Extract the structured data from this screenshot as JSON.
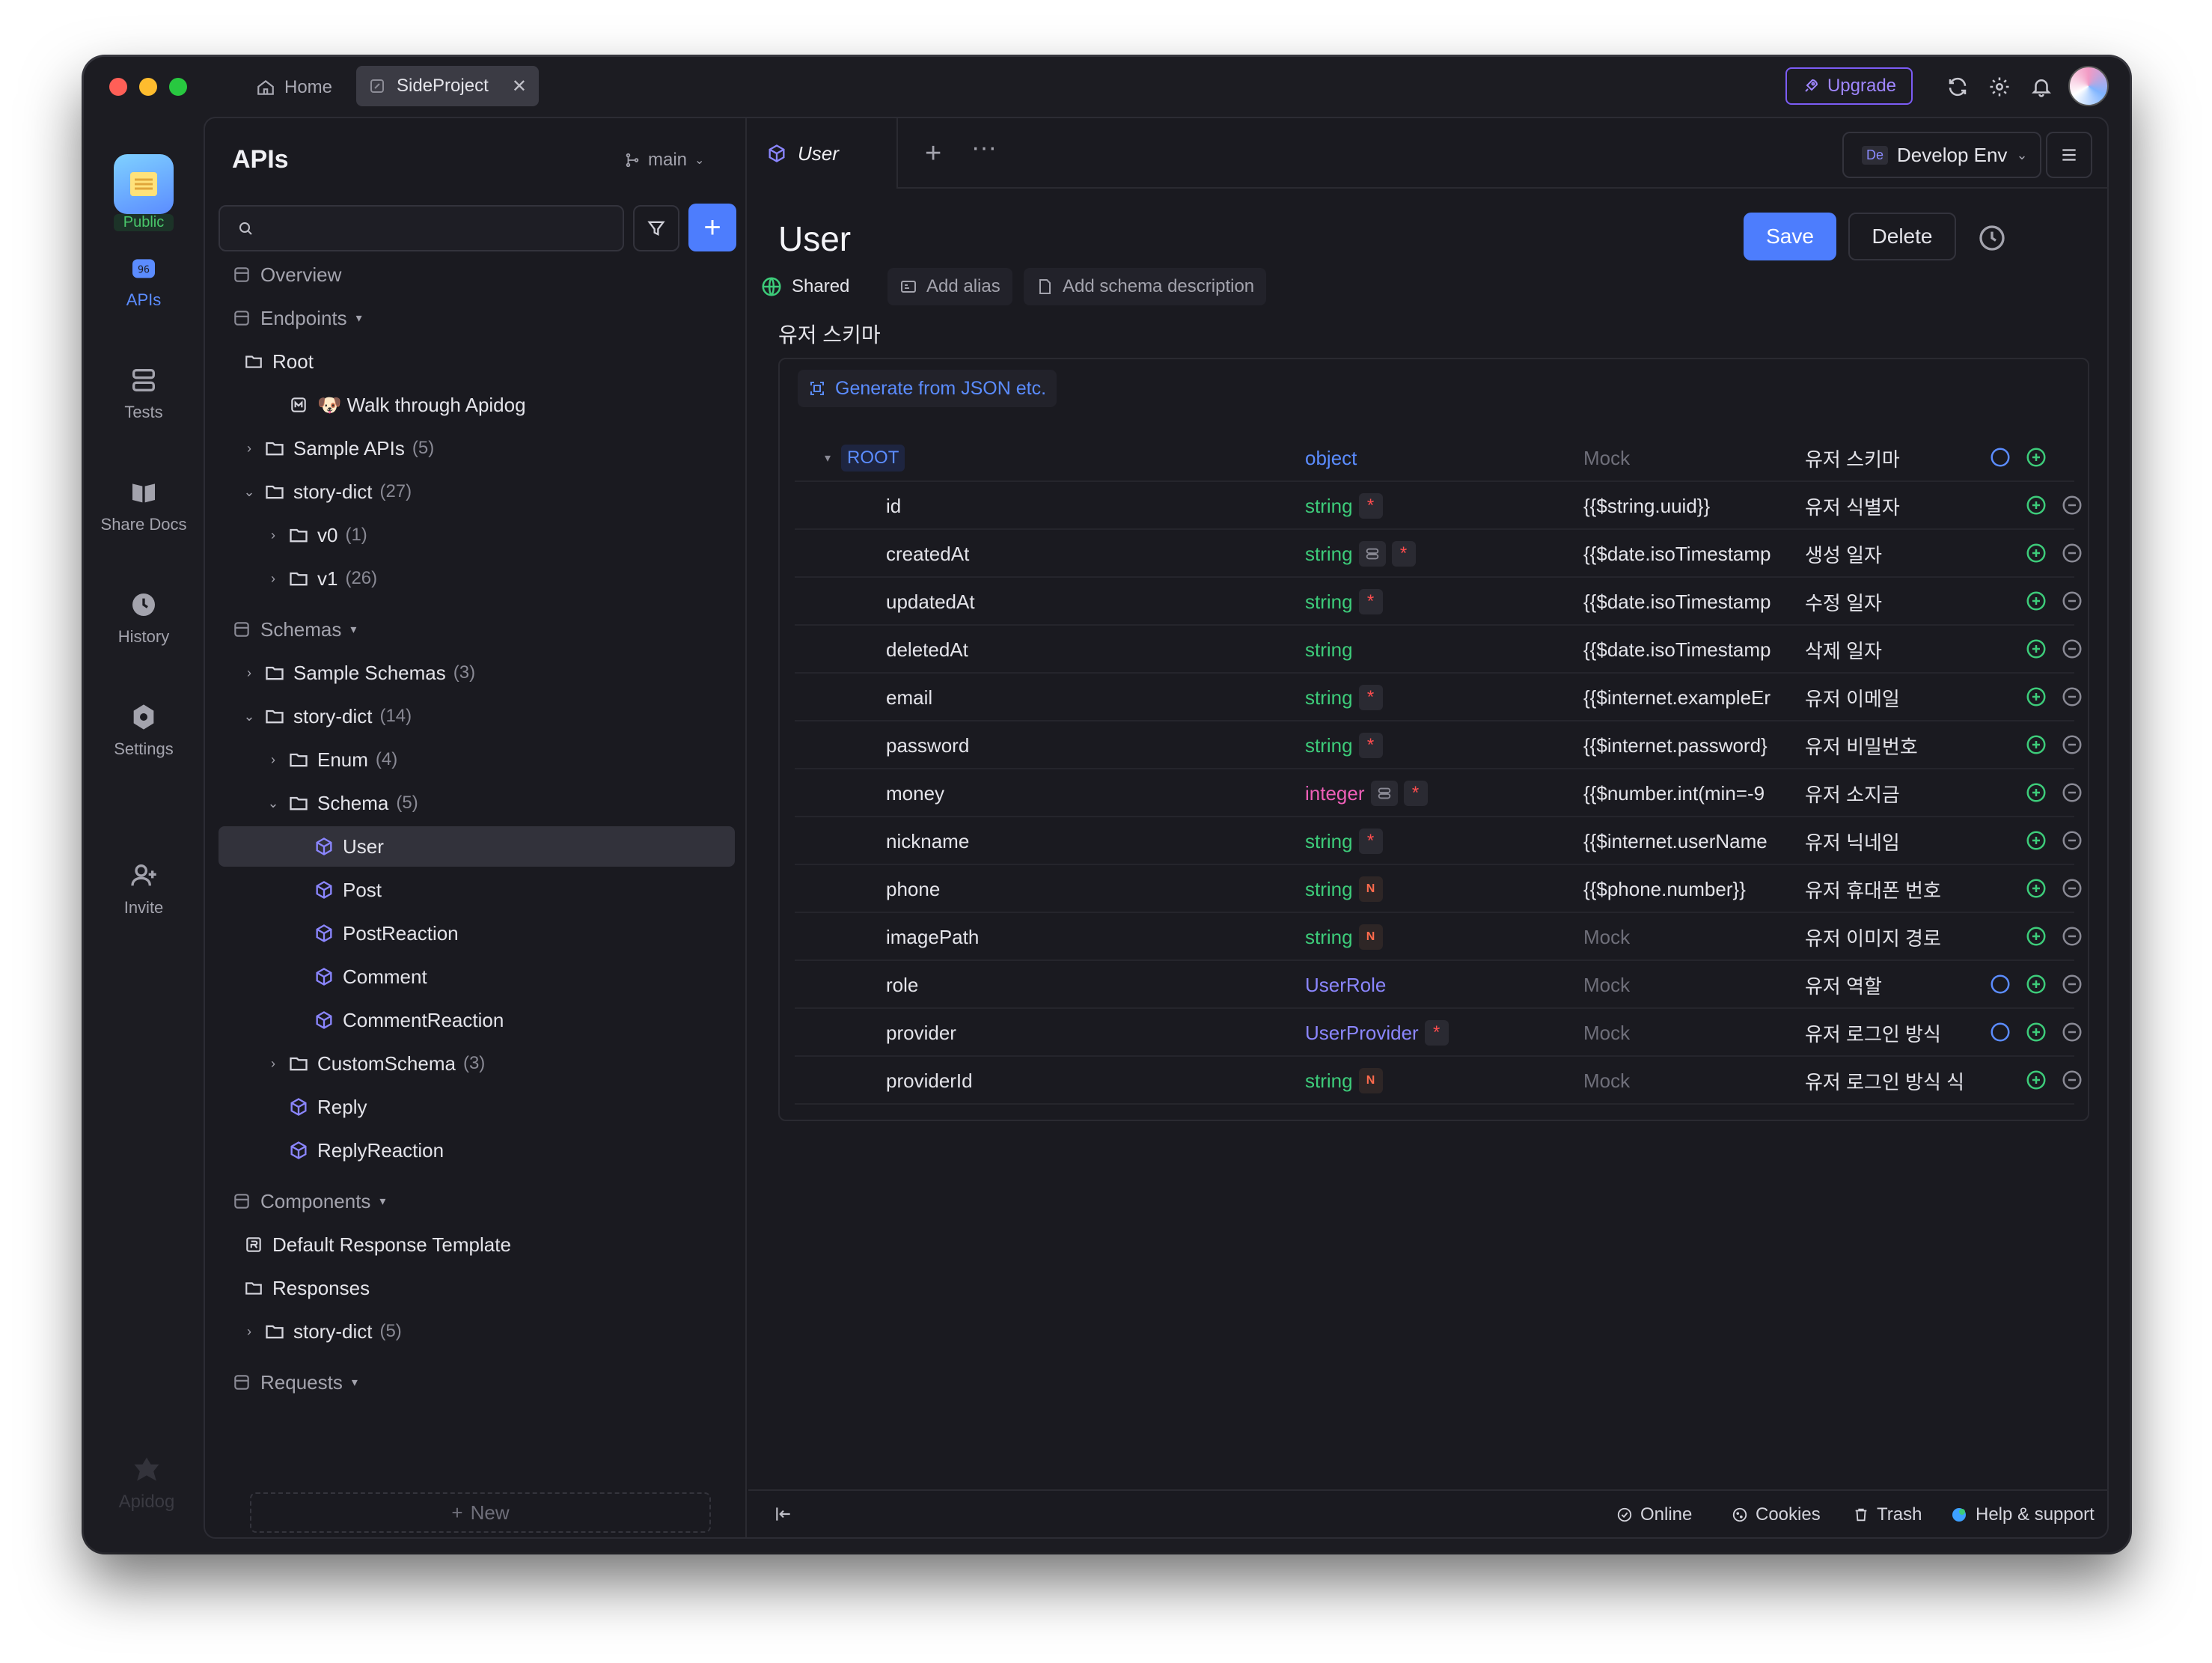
{
  "titlebar": {
    "tabs": [
      {
        "label": "Home",
        "icon": "home-icon",
        "active": false
      },
      {
        "label": "SideProject",
        "icon": "project-icon",
        "active": true
      }
    ],
    "upgrade_label": "Upgrade"
  },
  "rail": {
    "public_badge": "Public",
    "items": [
      {
        "label": "APIs",
        "icon": "api-icon",
        "active": true
      },
      {
        "label": "Tests",
        "icon": "tests-icon",
        "active": false
      },
      {
        "label": "Share Docs",
        "icon": "book-icon",
        "active": false
      },
      {
        "label": "History",
        "icon": "clock-icon",
        "active": false
      },
      {
        "label": "Settings",
        "icon": "settings-icon",
        "active": false
      },
      {
        "label": "Invite",
        "icon": "invite-icon",
        "active": false
      }
    ],
    "footer_brand": "Apidog"
  },
  "sidebar": {
    "title": "APIs",
    "branch": "main",
    "search_placeholder": "",
    "new_label": "New",
    "tree": [
      {
        "label": "Overview",
        "type": "section",
        "level": 0
      },
      {
        "label": "Endpoints",
        "type": "section",
        "level": 0,
        "caret": true
      },
      {
        "label": "Root",
        "type": "root",
        "level": 1
      },
      {
        "label": "🐶 Walk through Apidog",
        "type": "md",
        "level": 2
      },
      {
        "label": "Sample APIs",
        "count": "(5)",
        "type": "folder",
        "level": 1,
        "expand": "closed"
      },
      {
        "label": "story-dict",
        "count": "(27)",
        "type": "folder",
        "level": 1,
        "expand": "open"
      },
      {
        "label": "v0",
        "count": "(1)",
        "type": "folder",
        "level": 2,
        "expand": "closed"
      },
      {
        "label": "v1",
        "count": "(26)",
        "type": "folder",
        "level": 2,
        "expand": "closed"
      },
      {
        "label": "Schemas",
        "type": "section",
        "level": 0,
        "caret": true
      },
      {
        "label": "Sample Schemas",
        "count": "(3)",
        "type": "folder",
        "level": 1,
        "expand": "closed"
      },
      {
        "label": "story-dict",
        "count": "(14)",
        "type": "folder",
        "level": 1,
        "expand": "open"
      },
      {
        "label": "Enum",
        "count": "(4)",
        "type": "folder",
        "level": 2,
        "expand": "closed"
      },
      {
        "label": "Schema",
        "count": "(5)",
        "type": "folder",
        "level": 2,
        "expand": "open"
      },
      {
        "label": "User",
        "type": "schema",
        "level": 3,
        "selected": true
      },
      {
        "label": "Post",
        "type": "schema",
        "level": 3
      },
      {
        "label": "PostReaction",
        "type": "schema",
        "level": 3
      },
      {
        "label": "Comment",
        "type": "schema",
        "level": 3
      },
      {
        "label": "CommentReaction",
        "type": "schema",
        "level": 3
      },
      {
        "label": "CustomSchema",
        "count": "(3)",
        "type": "folder",
        "level": 2,
        "expand": "closed"
      },
      {
        "label": "Reply",
        "type": "schema",
        "level": 2
      },
      {
        "label": "ReplyReaction",
        "type": "schema",
        "level": 2
      },
      {
        "label": "Components",
        "type": "section",
        "level": 0,
        "caret": true
      },
      {
        "label": "Default Response Template",
        "type": "template",
        "level": 1
      },
      {
        "label": "Responses",
        "type": "responses",
        "level": 1
      },
      {
        "label": "story-dict",
        "count": "(5)",
        "type": "folder",
        "level": 1,
        "expand": "closed"
      },
      {
        "label": "Requests",
        "type": "section",
        "level": 0,
        "caret": true
      }
    ]
  },
  "editor": {
    "tab_label": "User",
    "env_abbr": "De",
    "env_label": "Develop Env",
    "title": "User",
    "save_label": "Save",
    "delete_label": "Delete",
    "shared_label": "Shared",
    "add_alias_label": "Add alias",
    "add_desc_label": "Add schema description",
    "description": "유저 스키마",
    "generate_label": "Generate from JSON etc.",
    "root": {
      "name": "ROOT",
      "type": "object",
      "mock": "Mock",
      "desc": "유저 스키마"
    },
    "fields": [
      {
        "name": "id",
        "type": "string",
        "kind": "str",
        "required": true,
        "nullable": false,
        "link": false,
        "mock": "{{$string.uuid}}",
        "mock_placeholder": false,
        "desc": "유저 식별자",
        "ref": false
      },
      {
        "name": "createdAt",
        "type": "string",
        "kind": "str",
        "required": true,
        "nullable": false,
        "link": true,
        "mock": "{{$date.isoTimestamp",
        "mock_placeholder": false,
        "desc": "생성 일자",
        "ref": false
      },
      {
        "name": "updatedAt",
        "type": "string",
        "kind": "str",
        "required": true,
        "nullable": false,
        "link": false,
        "mock": "{{$date.isoTimestamp",
        "mock_placeholder": false,
        "desc": "수정 일자",
        "ref": false
      },
      {
        "name": "deletedAt",
        "type": "string",
        "kind": "str",
        "required": false,
        "nullable": false,
        "link": false,
        "mock": "{{$date.isoTimestamp",
        "mock_placeholder": false,
        "desc": "삭제 일자",
        "ref": false
      },
      {
        "name": "email",
        "type": "string",
        "kind": "str",
        "required": true,
        "nullable": false,
        "link": false,
        "mock": "{{$internet.exampleEr",
        "mock_placeholder": false,
        "desc": "유저 이메일",
        "ref": false
      },
      {
        "name": "password",
        "type": "string",
        "kind": "str",
        "required": true,
        "nullable": false,
        "link": false,
        "mock": "{{$internet.password}",
        "mock_placeholder": false,
        "desc": "유저 비밀번호",
        "ref": false
      },
      {
        "name": "money",
        "type": "integer",
        "kind": "int",
        "required": true,
        "nullable": false,
        "link": true,
        "mock": "{{$number.int(min=-9",
        "mock_placeholder": false,
        "desc": "유저 소지금",
        "ref": false
      },
      {
        "name": "nickname",
        "type": "string",
        "kind": "str",
        "required": true,
        "nullable": false,
        "link": false,
        "mock": "{{$internet.userName",
        "mock_placeholder": false,
        "desc": "유저 닉네임",
        "ref": false
      },
      {
        "name": "phone",
        "type": "string",
        "kind": "str",
        "required": false,
        "nullable": true,
        "link": false,
        "mock": "{{$phone.number}}",
        "mock_placeholder": false,
        "desc": "유저 휴대폰 번호",
        "ref": false
      },
      {
        "name": "imagePath",
        "type": "string",
        "kind": "str",
        "required": false,
        "nullable": true,
        "link": false,
        "mock": "Mock",
        "mock_placeholder": true,
        "desc": "유저 이미지 경로",
        "ref": false
      },
      {
        "name": "role",
        "type": "UserRole",
        "kind": "ref",
        "required": false,
        "nullable": false,
        "link": false,
        "mock": "Mock",
        "mock_placeholder": true,
        "desc": "유저 역할",
        "ref": true
      },
      {
        "name": "provider",
        "type": "UserProvider",
        "kind": "ref",
        "required": true,
        "nullable": false,
        "link": false,
        "mock": "Mock",
        "mock_placeholder": true,
        "desc": "유저 로그인 방식",
        "ref": true
      },
      {
        "name": "providerId",
        "type": "string",
        "kind": "str",
        "required": false,
        "nullable": true,
        "link": false,
        "mock": "Mock",
        "mock_placeholder": true,
        "desc": "유저 로그인 방식 식",
        "ref": false
      }
    ],
    "required_mark": "*",
    "nullable_mark": "N"
  },
  "footer": {
    "online": "Online",
    "cookies": "Cookies",
    "trash": "Trash",
    "help": "Help & support"
  },
  "colors": {
    "accent": "#4d7dfd",
    "string_type": "#3dcc7a",
    "integer_type": "#ef5fb8",
    "ref_type": "#8b86ff",
    "required": "#ff4d4f",
    "upgrade": "#7c5cf5"
  }
}
